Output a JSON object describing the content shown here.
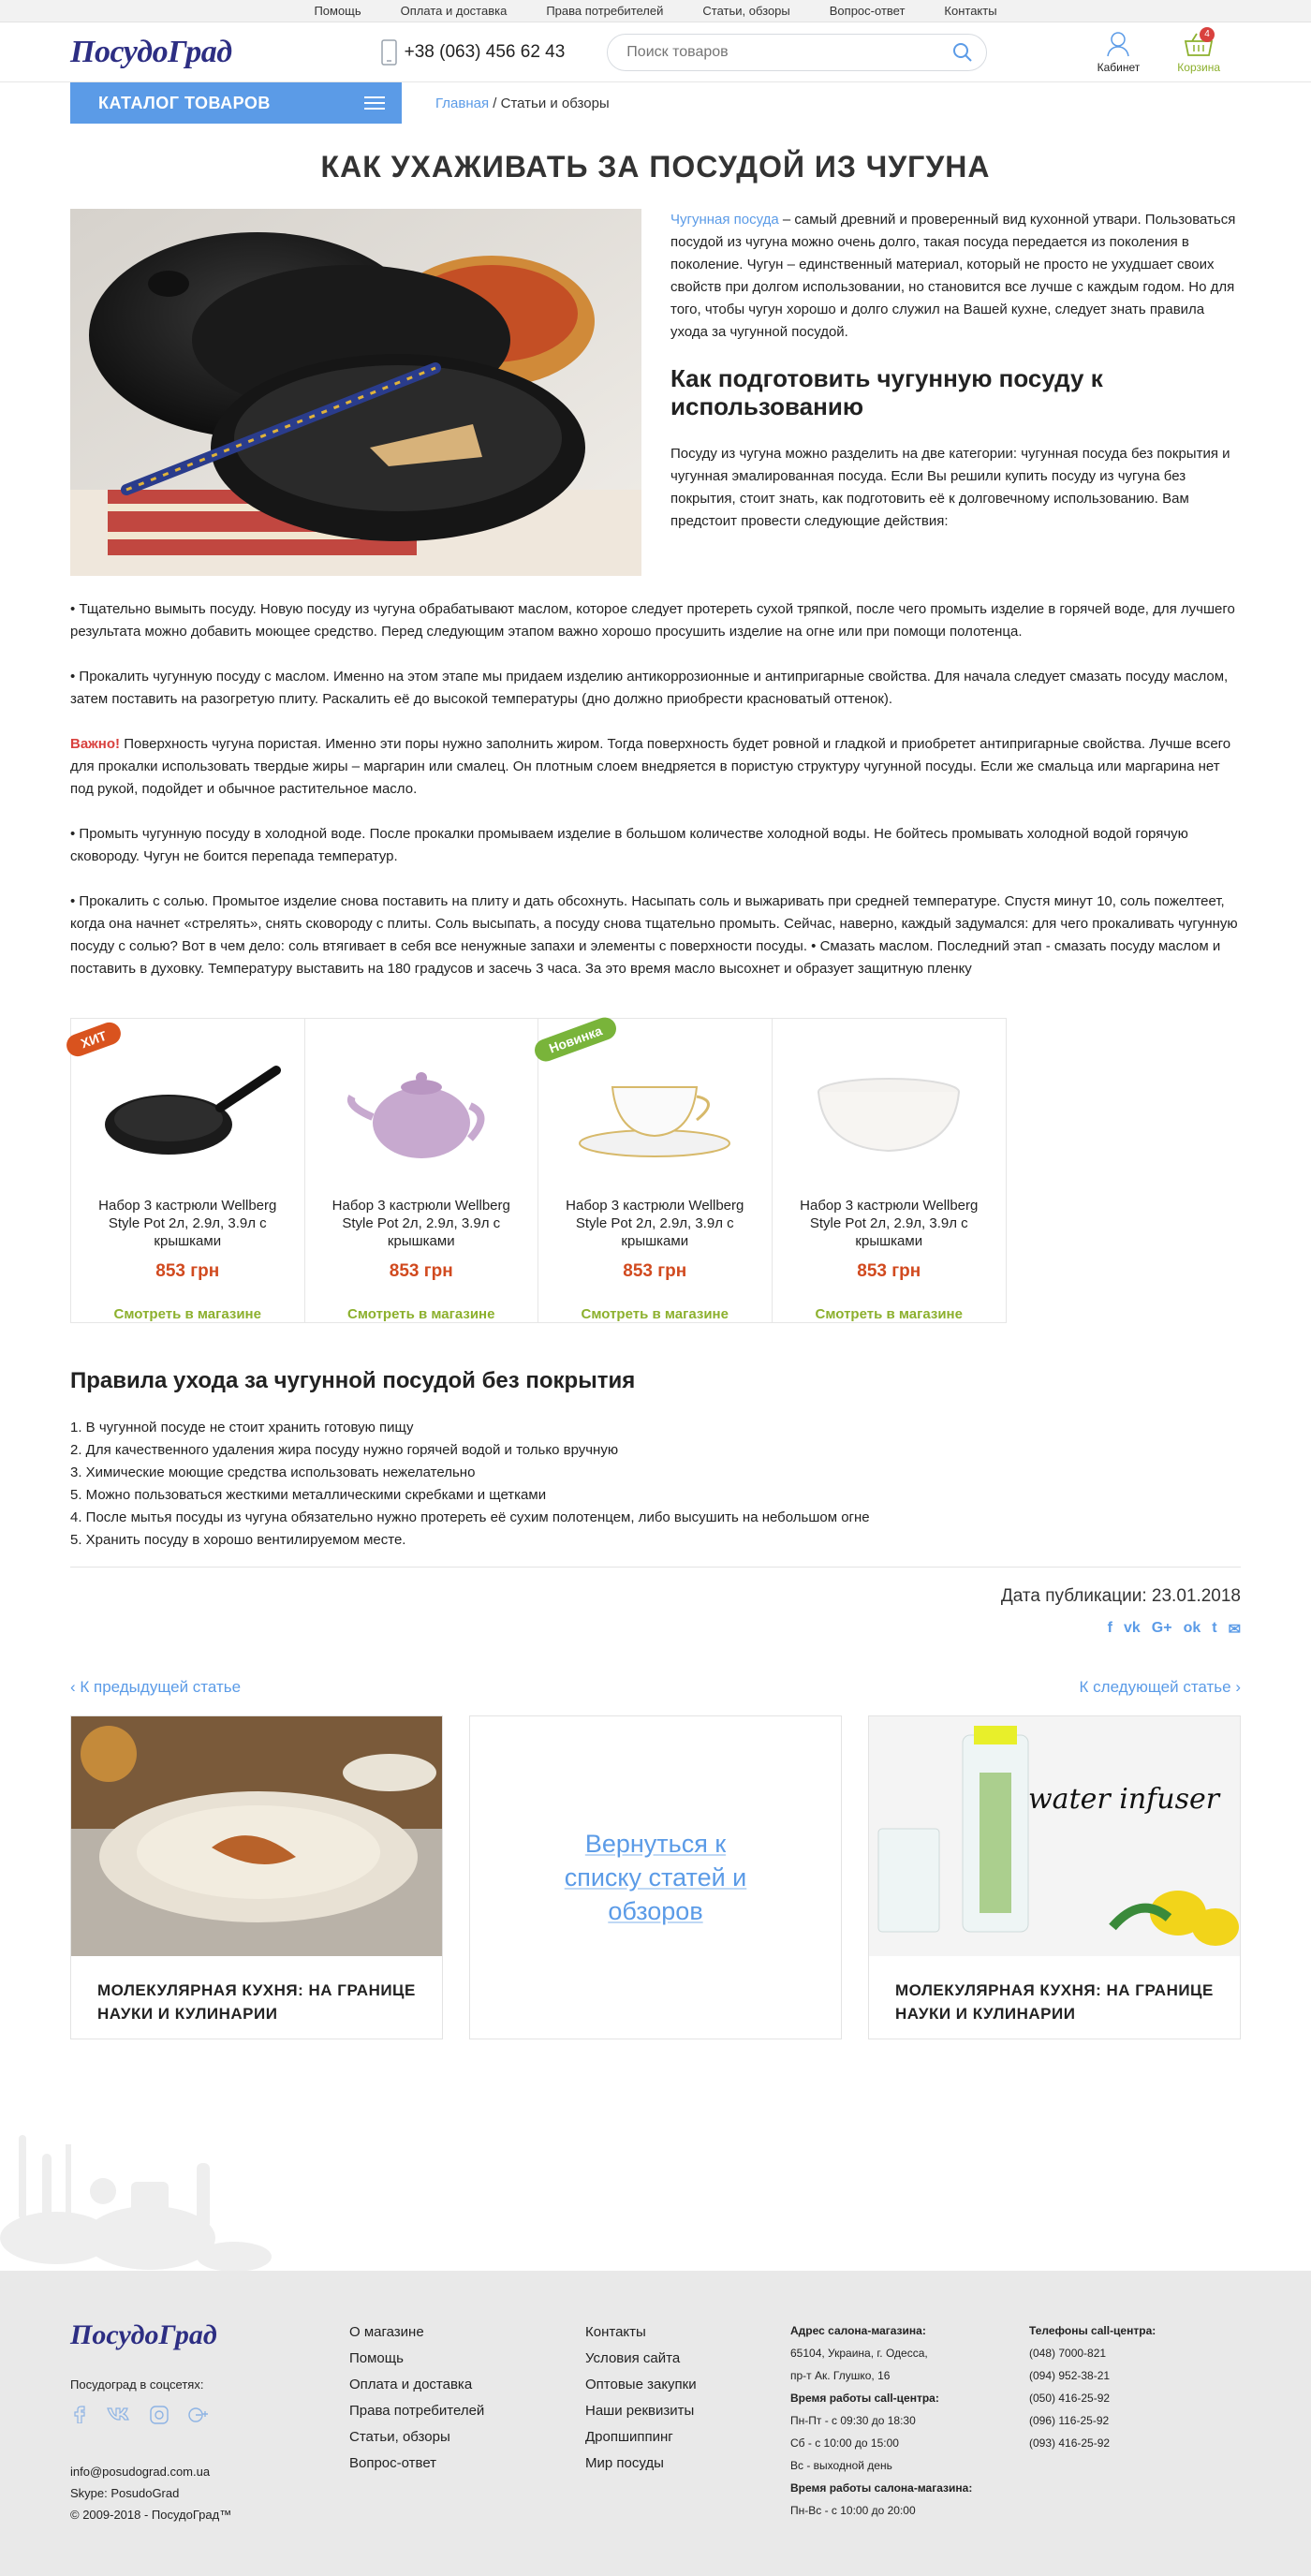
{
  "topnav": [
    "Помощь",
    "Оплата и доставка",
    "Права потребителей",
    "Статьи, обзоры",
    "Вопрос-ответ",
    "Контакты"
  ],
  "header": {
    "logo": "ПосудоГрад",
    "phone": "+38 (063) 456 62 43",
    "search_placeholder": "Поиск товаров",
    "cabinet": "Кабинет",
    "cart": "Корзина",
    "cart_count": "4"
  },
  "catalog_label": "КАТАЛОГ ТОВАРОВ",
  "breadcrumb": {
    "home": "Главная",
    "sep": " / ",
    "current": "Статьи и обзоры"
  },
  "article": {
    "title": "КАК УХАЖИВАТЬ ЗА ПОСУДОЙ ИЗ ЧУГУНА",
    "intro_link": "Чугунная посуда",
    "intro_rest": " – самый древний и проверенный вид кухонной утвари. Пользоваться посудой из чугуна можно очень долго, такая посуда передается из поколения в поколение. Чугун – единственный материал, который не просто не ухудшает своих свойств при долгом использовании, но становится все лучше с каждым годом. Но для того, чтобы чугун хорошо и долго служил на Вашей кухне, следует знать правила ухода за чугунной посудой.",
    "subtitle": "Как подготовить чугунную посуду к использованию",
    "subintro": "Посуду из чугуна можно разделить на две категории: чугунная посуда без покрытия и чугунная эмалированная посуда. Если Вы решили купить посуду из чугуна без покрытия, стоит знать, как подготовить её к долговечному использованию. Вам предстоит провести следующие действия:",
    "p1": "• Тщательно вымыть посуду. Новую посуду из чугуна обрабатывают маслом, которое следует протереть сухой тряпкой, после чего промыть изделие в горячей воде, для лучшего результата можно добавить моющее средство. Перед следующим этапом важно хорошо просушить изделие на огне или при помощи полотенца.",
    "p2": "• Прокалить чугунную посуду с маслом. Именно на этом этапе мы придаем изделию антикоррозионные и антипригарные свойства. Для начала следует смазать посуду маслом, затем поставить на разогретую плиту. Раскалить её до высокой температуры (дно должно приобрести красноватый оттенок).",
    "important": "Важно!",
    "p3": " Поверхность чугуна пористая. Именно эти поры нужно заполнить жиром. Тогда поверхность будет ровной и гладкой и приобретет антипригарные свойства. Лучше всего для прокалки использовать твердые жиры – маргарин или смалец. Он плотным слоем внедряется в пористую структуру чугунной посуды. Если же смальца или маргарина нет под рукой, подойдет и обычное растительное масло.",
    "p4": "• Промыть чугунную посуду в холодной воде. После прокалки промываем изделие в большом количестве холодной воды. Не бойтесь промывать холодной водой горячую сковороду. Чугун не боится перепада температур.",
    "p5": "• Прокалить с солью. Промытое изделие снова поставить на плиту и дать обсохнуть. Насыпать соль и выжаривать при средней температуре. Спустя минут 10, соль пожелтеет, когда она начнет «стрелять», снять сковороду с плиты. Соль высыпать, а посуду снова тщательно промыть. Сейчас, наверно, каждый задумался: для чего прокаливать чугунную посуду с солью? Вот в чем дело: соль втягивает в себя все ненужные запахи и элементы с поверхности посуды. • Смазать маслом. Последний этап - смазать посуду маслом и поставить в духовку. Температуру выставить на 180 градусов и засечь 3 часа. За это время масло высохнет и образует защитную пленку"
  },
  "products": [
    {
      "tag": "ХИТ",
      "name": "Набор 3 кастрюли Wellberg Style Pot 2л, 2.9л, 3.9л с крышками",
      "price": "853 грн",
      "link": "Смотреть в магазине"
    },
    {
      "tag": "",
      "name": "Набор 3 кастрюли Wellberg Style Pot 2л, 2.9л, 3.9л с крышками",
      "price": "853 грн",
      "link": "Смотреть в магазине"
    },
    {
      "tag": "Новинка",
      "name": "Набор 3 кастрюли Wellberg Style Pot 2л, 2.9л, 3.9л с крышками",
      "price": "853 грн",
      "link": "Смотреть в магазине"
    },
    {
      "tag": "",
      "name": "Набор 3 кастрюли Wellberg Style Pot 2л, 2.9л, 3.9л с крышками",
      "price": "853 грн",
      "link": "Смотреть в магазине"
    }
  ],
  "rules": {
    "title": "Правила ухода за чугунной посудой без покрытия",
    "items": [
      "1. В чугунной посуде не стоит хранить готовую пищу",
      "2. Для качественного удаления жира посуду нужно горячей водой и только вручную",
      "3. Химические моющие средства использовать нежелательно",
      "5. Можно пользоваться жесткими металлическими скребками и щетками",
      "4. После мытья посуды из чугуна обязательно нужно протереть её сухим полотенцем, либо высушить на небольшом огне",
      "5. Хранить посуду в хорошо вентилируемом месте."
    ]
  },
  "published": "Дата публикации: 23.01.2018",
  "nav": {
    "prev": "К предыдущей статье",
    "next": "К следующей статье"
  },
  "cards": {
    "left": "МОЛЕКУЛЯРНАЯ КУХНЯ: НА ГРАНИЦЕ НАУКИ И КУЛИНАРИИ",
    "back": "Вернуться к списку статей и обзоров",
    "right": "МОЛЕКУЛЯРНАЯ КУХНЯ: НА ГРАНИЦЕ НАУКИ И КУЛИНАРИИ",
    "right_caption": "water infuser"
  },
  "footer": {
    "logo": "ПосудоГрад",
    "social_title": "Посудоград в соцсетях:",
    "email": "info@posudograd.com.ua",
    "skype": "Skype: PosudoGrad",
    "copyright": "© 2009-2018 - ПосудоГрад™",
    "col1": [
      "О магазине",
      "Помощь",
      "Оплата и доставка",
      "Права потребителей",
      "Статьи, обзоры",
      "Вопрос-ответ"
    ],
    "col2": [
      "Контакты",
      "Условия сайта",
      "Оптовые закупки",
      "Наши реквизиты",
      "Дропшиппинг",
      "Мир посуды"
    ],
    "addr_title": "Адрес салона-магазина:",
    "addr1": "65104, Украина, г. Одесса,",
    "addr2": "пр-т Ак. Глушко, 16",
    "hours_title": "Время работы call-центра:",
    "hours1": "Пн-Пт - с 09:30 до 18:30",
    "hours2": "Сб - с 10:00 до 15:00",
    "hours3": "Вс - выходной день",
    "shop_title": "Время работы салона-магазина:",
    "shop1": "Пн-Вс - с 10:00 до 20:00",
    "phones_title": "Телефоны call-центра:",
    "phones": [
      "(048) 7000-821",
      "(094) 952-38-21",
      "(050) 416-25-92",
      "(096) 116-25-92",
      "(093) 416-25-92"
    ]
  },
  "colors": {
    "accent": "#5b9be7",
    "brand": "#2d2e83",
    "price": "#d14a1f",
    "link_green": "#8cb02d",
    "hit": "#d9531e",
    "new": "#79b43a"
  }
}
